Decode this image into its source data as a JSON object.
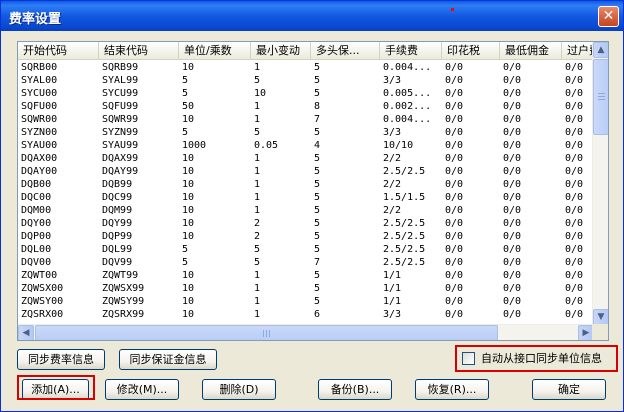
{
  "window": {
    "title": "费率设置",
    "close_glyph": "✕"
  },
  "table": {
    "columns": [
      "开始代码",
      "结束代码",
      "单位/乘数",
      "最小变动",
      "多头保...",
      "手续费",
      "印花税",
      "最低佣金",
      "过户费"
    ],
    "rows": [
      [
        "SQRB00",
        "SQRB99",
        "10",
        "1",
        "5",
        "0.004...",
        "0/0",
        "0/0",
        "0/0"
      ],
      [
        "SYAL00",
        "SYAL99",
        "5",
        "5",
        "5",
        "3/3",
        "0/0",
        "0/0",
        "0/0"
      ],
      [
        "SYCU00",
        "SYCU99",
        "5",
        "10",
        "5",
        "0.005...",
        "0/0",
        "0/0",
        "0/0"
      ],
      [
        "SQFU00",
        "SQFU99",
        "50",
        "1",
        "8",
        "0.002...",
        "0/0",
        "0/0",
        "0/0"
      ],
      [
        "SQWR00",
        "SQWR99",
        "10",
        "1",
        "7",
        "0.004...",
        "0/0",
        "0/0",
        "0/0"
      ],
      [
        "SYZN00",
        "SYZN99",
        "5",
        "5",
        "5",
        "3/3",
        "0/0",
        "0/0",
        "0/0"
      ],
      [
        "SYAU00",
        "SYAU99",
        "1000",
        "0.05",
        "4",
        "10/10",
        "0/0",
        "0/0",
        "0/0"
      ],
      [
        "DQAX00",
        "DQAX99",
        "10",
        "1",
        "5",
        "2/2",
        "0/0",
        "0/0",
        "0/0"
      ],
      [
        "DQAY00",
        "DQAY99",
        "10",
        "1",
        "5",
        "2.5/2.5",
        "0/0",
        "0/0",
        "0/0"
      ],
      [
        "DQB00",
        "DQB99",
        "10",
        "1",
        "5",
        "2/2",
        "0/0",
        "0/0",
        "0/0"
      ],
      [
        "DQC00",
        "DQC99",
        "10",
        "1",
        "5",
        "1.5/1.5",
        "0/0",
        "0/0",
        "0/0"
      ],
      [
        "DQM00",
        "DQM99",
        "10",
        "1",
        "5",
        "2/2",
        "0/0",
        "0/0",
        "0/0"
      ],
      [
        "DQY00",
        "DQY99",
        "10",
        "2",
        "5",
        "2.5/2.5",
        "0/0",
        "0/0",
        "0/0"
      ],
      [
        "DQP00",
        "DQP99",
        "10",
        "2",
        "5",
        "2.5/2.5",
        "0/0",
        "0/0",
        "0/0"
      ],
      [
        "DQL00",
        "DQL99",
        "5",
        "5",
        "5",
        "2.5/2.5",
        "0/0",
        "0/0",
        "0/0"
      ],
      [
        "DQV00",
        "DQV99",
        "5",
        "5",
        "7",
        "2.5/2.5",
        "0/0",
        "0/0",
        "0/0"
      ],
      [
        "ZQWT00",
        "ZQWT99",
        "10",
        "1",
        "5",
        "1/1",
        "0/0",
        "0/0",
        "0/0"
      ],
      [
        "ZQWSX00",
        "ZQWSX99",
        "10",
        "1",
        "5",
        "1/1",
        "0/0",
        "0/0",
        "0/0"
      ],
      [
        "ZQWSY00",
        "ZQWSY99",
        "10",
        "1",
        "5",
        "1/1",
        "0/0",
        "0/0",
        "0/0"
      ],
      [
        "ZQSRX00",
        "ZQSRX99",
        "10",
        "1",
        "6",
        "3/3",
        "0/0",
        "0/0",
        "0/0"
      ]
    ]
  },
  "scrollbar": {
    "up": "▲",
    "down": "▼",
    "left": "◀",
    "right": "▶"
  },
  "buttons": {
    "sync_rate": "同步费率信息",
    "sync_margin": "同步保证金信息",
    "add": "添加(A)...",
    "modify": "修改(M)...",
    "delete": "删除(D)",
    "backup": "备份(B)...",
    "restore": "恢复(R)...",
    "ok": "确定"
  },
  "auto_sync": {
    "label": "自动从接口同步单位信息",
    "checked": false
  }
}
